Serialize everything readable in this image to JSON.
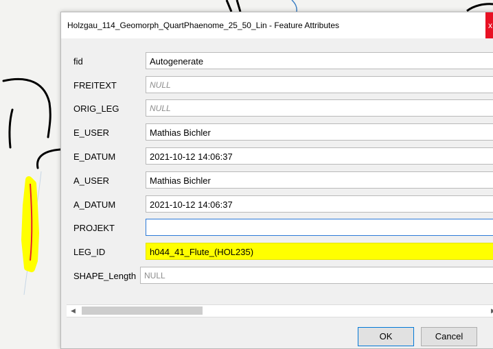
{
  "dialog": {
    "title": "Holzgau_114_Geomorph_QuartPhaenome_25_50_Lin - Feature Attributes",
    "close_label": "x"
  },
  "fields": [
    {
      "label": "fid",
      "value": "Autogenerate"
    },
    {
      "label": "FREITEXT",
      "value": "NULL"
    },
    {
      "label": "ORIG_LEG",
      "value": "NULL"
    },
    {
      "label": "E_USER",
      "value": "Mathias Bichler"
    },
    {
      "label": "E_DATUM",
      "value": "2021-10-12 14:06:37"
    },
    {
      "label": "A_USER",
      "value": "Mathias Bichler"
    },
    {
      "label": "A_DATUM",
      "value": "2021-10-12 14:06:37"
    },
    {
      "label": "PROJEKT",
      "value": ""
    },
    {
      "label": "LEG_ID",
      "value": "h044_41_Flute_(HOL235)"
    },
    {
      "label": "SHAPE_Length",
      "value": "NULL"
    }
  ],
  "scrollbar": {
    "left_arrow": "◀",
    "right_arrow": "▶"
  },
  "buttons": {
    "ok_label": "OK",
    "cancel_label": "Cancel"
  },
  "colors": {
    "highlight": "#ffff00",
    "map_line": "#000000",
    "feature_line": "#e8202a",
    "close_button": "#e81123",
    "focus_border": "#2b79d8"
  }
}
